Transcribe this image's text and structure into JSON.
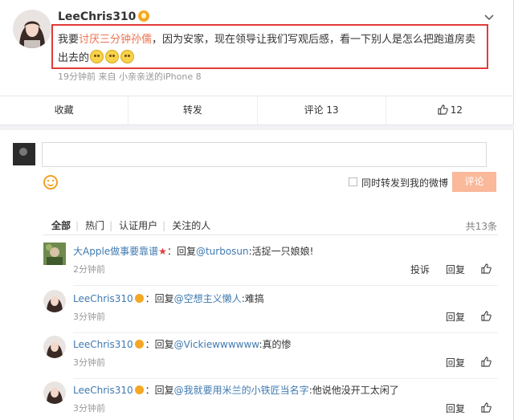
{
  "post": {
    "username": "LeeChris310",
    "text_before": "我要",
    "text_highlight": "讨厌三分钟孙儒",
    "text_after": "，因为安家，现在领导让我们写观后感，看一下别人是怎么把跑道房卖出去的",
    "meta": "19分钟前  来自 小亲亲送的iPhone 8"
  },
  "actions": {
    "favorite": "收藏",
    "repost": "转发",
    "comment": "评论 13",
    "like": "12"
  },
  "compose": {
    "repost_label": "同时转发到我的微博",
    "submit": "评论"
  },
  "filters": {
    "all": "全部",
    "hot": "热门",
    "verified": "认证用户",
    "following": "关注的人",
    "total": "共13条"
  },
  "comments": [
    {
      "user": "大Apple做事要靠谱",
      "reply_prefix": "：回复",
      "mention": "@turbosun",
      "body": ":活捉一只娘娘!",
      "time": "2分钟前",
      "report": "投诉",
      "reply": "回复"
    },
    {
      "user": "LeeChris310",
      "reply_prefix": "：回复",
      "mention": "@空想主义懒人",
      "body": ":难搞",
      "time": "3分钟前",
      "reply": "回复"
    },
    {
      "user": "LeeChris310",
      "reply_prefix": "：回复",
      "mention": "@Vickiewwwwww",
      "body": ":真的惨",
      "time": "3分钟前",
      "reply": "回复"
    },
    {
      "user": "LeeChris310",
      "reply_prefix": "：回复",
      "mention": "@我就要用米兰的小铁匠当名字",
      "body": ":他说他没开工太闲了",
      "time": "3分钟前",
      "reply": "回复"
    }
  ],
  "colors": {
    "highlight_border": "#e23b3b",
    "link": "#3f7ab0",
    "accent_orange": "#eb7350",
    "submit_bg": "#f9b99a"
  }
}
